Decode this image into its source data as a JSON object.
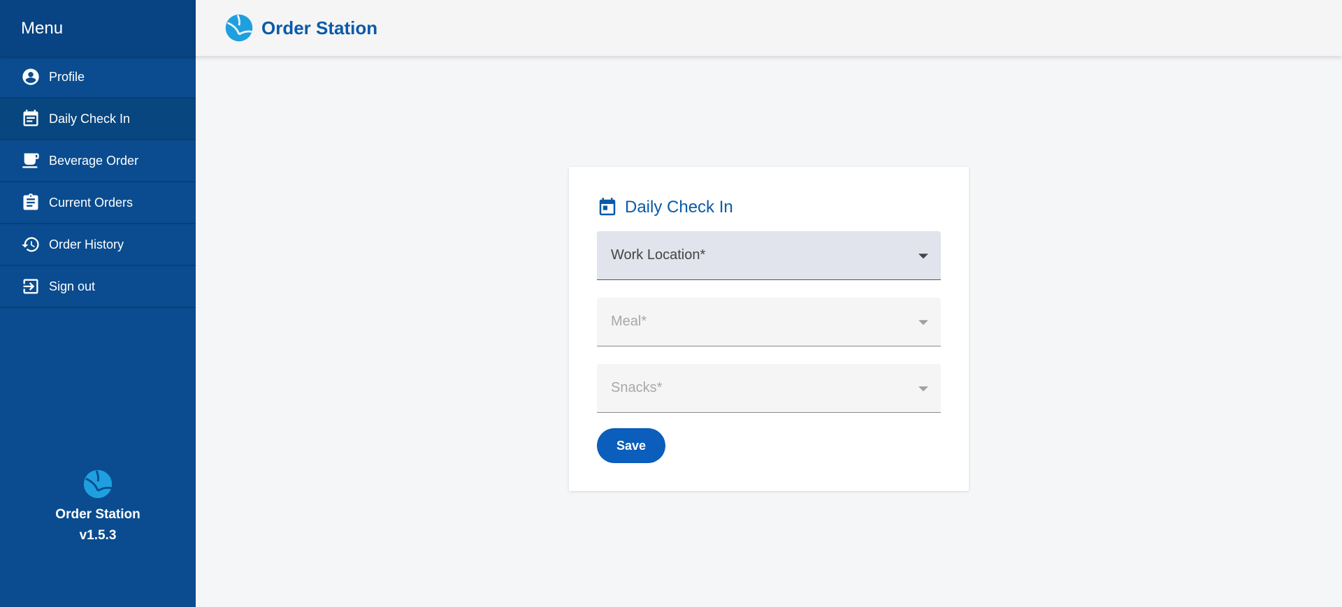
{
  "sidebar": {
    "header": "Menu",
    "items": [
      {
        "label": "Profile",
        "icon": "account-circle-icon",
        "active": false
      },
      {
        "label": "Daily Check In",
        "icon": "calendar-note-icon",
        "active": true
      },
      {
        "label": "Beverage Order",
        "icon": "coffee-cup-icon",
        "active": false
      },
      {
        "label": "Current Orders",
        "icon": "clipboard-icon",
        "active": false
      },
      {
        "label": "Order History",
        "icon": "history-icon",
        "active": false
      },
      {
        "label": "Sign out",
        "icon": "sign-out-icon",
        "active": false
      }
    ],
    "footer": {
      "app_name": "Order Station",
      "version": "v1.5.3"
    }
  },
  "topbar": {
    "title": "Order Station"
  },
  "card": {
    "title": "Daily Check In",
    "fields": {
      "work_location": "Work Location*",
      "meal": "Meal*",
      "snacks": "Snacks*"
    },
    "save_label": "Save"
  },
  "colors": {
    "sidebar_bg": "#0a4c8f",
    "brand_blue": "#0a5aa8",
    "logo_blue": "#1ea0e0",
    "button_blue": "#0b5ebb"
  }
}
